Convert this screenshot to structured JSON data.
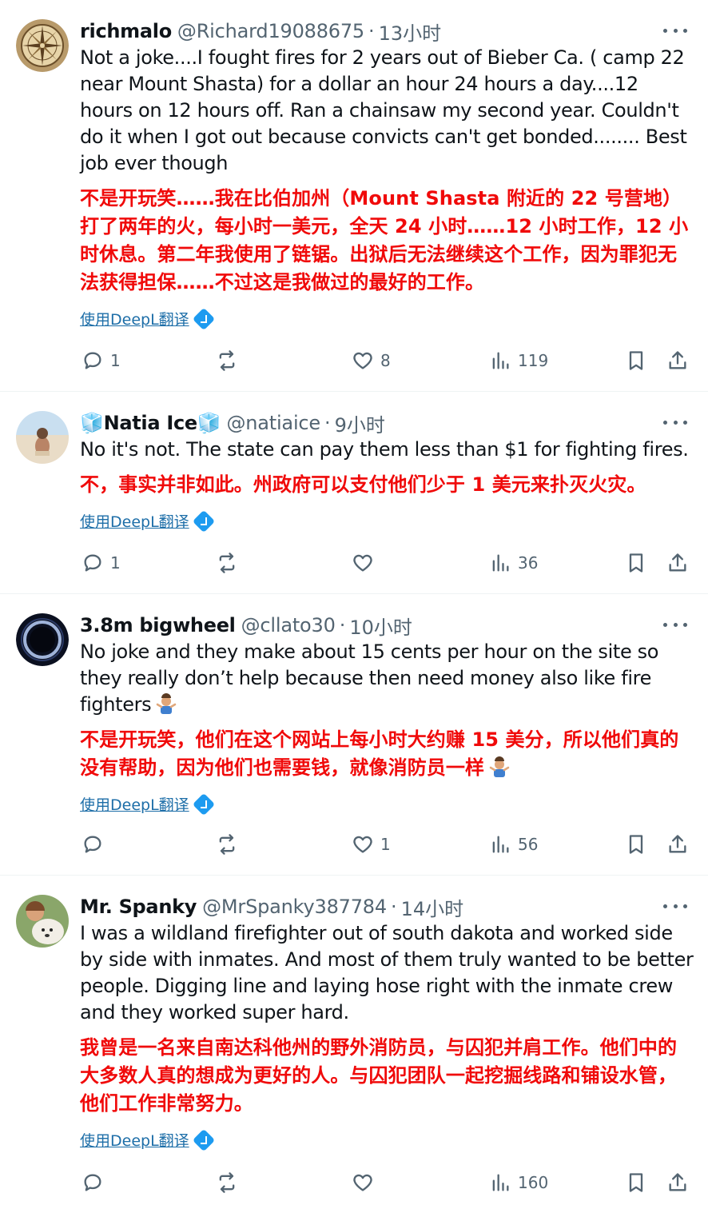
{
  "colors": {
    "accent": "#1d9bf0",
    "translation": "#f00a0a",
    "muted": "#536471"
  },
  "tweets": [
    {
      "name": "richmalo",
      "handle": "@Richard19088675",
      "time": "13小时",
      "text": "Not a joke....I fought fires for 2 years out of Bieber Ca. ( camp 22 near Mount Shasta) for a dollar an hour 24 hours a day....12 hours on 12 hours off. Ran a chainsaw my second year. Couldn't do it when I got out because convicts can't get bonded........ Best job ever though",
      "translation": "不是开玩笑……我在比伯加州（Mount Shasta 附近的 22 号营地）打了两年的火，每小时一美元，全天 24 小时……12 小时工作，12 小时休息。第二年我使用了链锯。出狱后无法继续这个工作，因为罪犯无法获得担保……不过这是我做过的最好的工作。",
      "translate_link": "使用DeepL翻译",
      "replies": "1",
      "retweets": "",
      "likes": "8",
      "views": "119"
    },
    {
      "name": "🧊Natia Ice🧊",
      "handle": "@natiaice",
      "time": "9小时",
      "text": "No it's not. The state can pay them less than $1 for fighting fires.",
      "translation": "不，事实并非如此。州政府可以支付他们少于 1 美元来扑灭火灾。",
      "translate_link": "使用DeepL翻译",
      "replies": "1",
      "retweets": "",
      "likes": "",
      "views": "36"
    },
    {
      "name": "3.8m bigwheel",
      "handle": "@cllato30",
      "time": "10小时",
      "text": "No joke and they make about 15 cents per hour on the site so they really don’t help because then need money also like fire fighters",
      "translation": "不是开玩笑，他们在这个网站上每小时大约赚 15 美分，所以他们真的没有帮助，因为他们也需要钱，就像消防员一样",
      "translate_link": "使用DeepL翻译",
      "replies": "",
      "retweets": "",
      "likes": "1",
      "views": "56",
      "emoji_icon": "person-shrugging-emoji"
    },
    {
      "name": "Mr. Spanky",
      "handle": "@MrSpanky387784",
      "time": "14小时",
      "text": "I was a wildland firefighter out of south dakota and worked side by side with inmates. And most of them truly wanted to be better people. Digging line and laying hose right with the inmate crew and they worked super hard.",
      "translation": "我曾是一名来自南达科他州的野外消防员，与囚犯并肩工作。他们中的大多数人真的想成为更好的人。与囚犯团队一起挖掘线路和铺设水管，他们工作非常努力。",
      "translate_link": "使用DeepL翻译",
      "replies": "",
      "retweets": "",
      "likes": "",
      "views": "160"
    }
  ]
}
